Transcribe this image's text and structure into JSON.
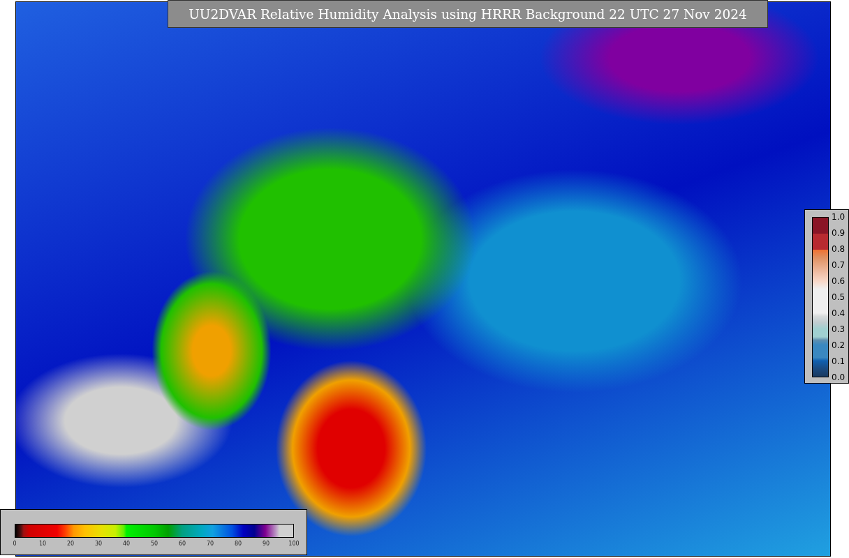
{
  "title": "UU2DVAR Relative Humidity Analysis using HRRR Background 22 UTC 27 Nov 2024",
  "humidity_colorbar": {
    "ticks": [
      "0",
      "10",
      "20",
      "30",
      "40",
      "50",
      "60",
      "70",
      "80",
      "90",
      "100"
    ]
  },
  "ratio_colorbar": {
    "ticks": [
      "1.0",
      "0.9",
      "0.8",
      "0.7",
      "0.6",
      "0.5",
      "0.4",
      "0.3",
      "0.2",
      "0.1",
      "0.0"
    ]
  }
}
